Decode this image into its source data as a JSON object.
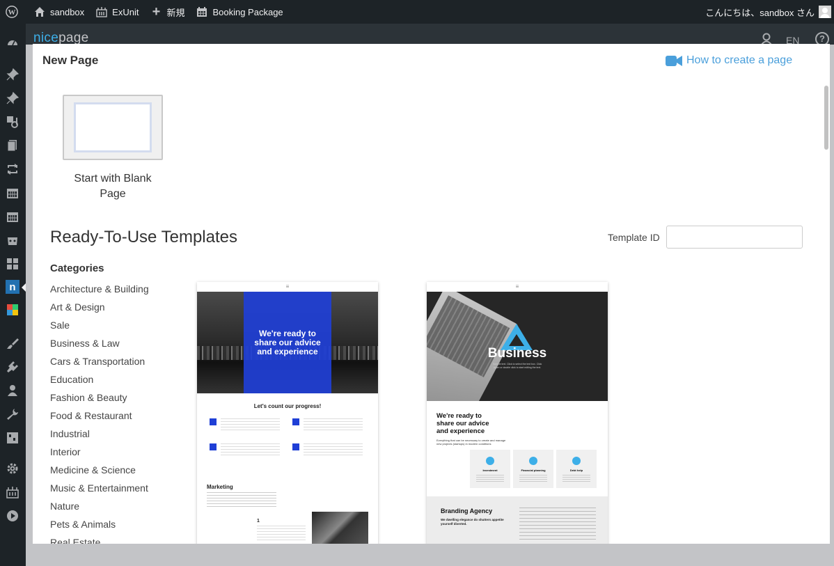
{
  "adminbar": {
    "site_name": "sandbox",
    "exunit_label": "ExUnit",
    "new_label": "新規",
    "booking_label": "Booking Package",
    "greeting": "こんにちは、sandbox さん"
  },
  "nicepage": {
    "logo_part1": "nice",
    "logo_part2": "page",
    "lang": "EN"
  },
  "modal": {
    "title": "New Page",
    "how_to_link": "How to create a page",
    "blank_label": "Start with Blank Page",
    "templates_heading": "Ready-To-Use Templates",
    "template_id_label": "Template ID",
    "template_id_value": "",
    "categories_heading": "Categories",
    "categories": [
      "Architecture & Building",
      "Art & Design",
      "Sale",
      "Business & Law",
      "Cars & Transportation",
      "Education",
      "Fashion & Beauty",
      "Food & Restaurant",
      "Industrial",
      "Interior",
      "Medicine & Science",
      "Music & Entertainment",
      "Nature",
      "Pets & Animals",
      "Real Estate"
    ]
  },
  "template1": {
    "hero_line1": "We're ready to",
    "hero_line2": "share our advice",
    "hero_line3": "and experience",
    "progress_heading": "Let's count our progress!",
    "marketing_heading": "Marketing",
    "step_number": "1"
  },
  "template2": {
    "hero_title": "Business",
    "hero_sub": "Sample text. Click to select the text box. Click again or double click to start editing the text.",
    "line1": "We're ready to",
    "line2": "share our advice",
    "line3": "and experience",
    "intro_text": "Everything that can be necessary to create and manage new projects (startups) in modern conditions",
    "feature1": "Investment",
    "feature2": "Financial planning",
    "feature3": "Debt help",
    "agency_heading": "Branding Agency",
    "agency_sub": "We dwelling elegance do shutters appetite yourself diverted."
  },
  "colors": {
    "wp_dark": "#1d2327",
    "link_blue": "#4a9fdb",
    "hero_blue": "#1f3fd6",
    "np_blue": "#2271b1",
    "accent_cyan": "#3dafe8"
  }
}
